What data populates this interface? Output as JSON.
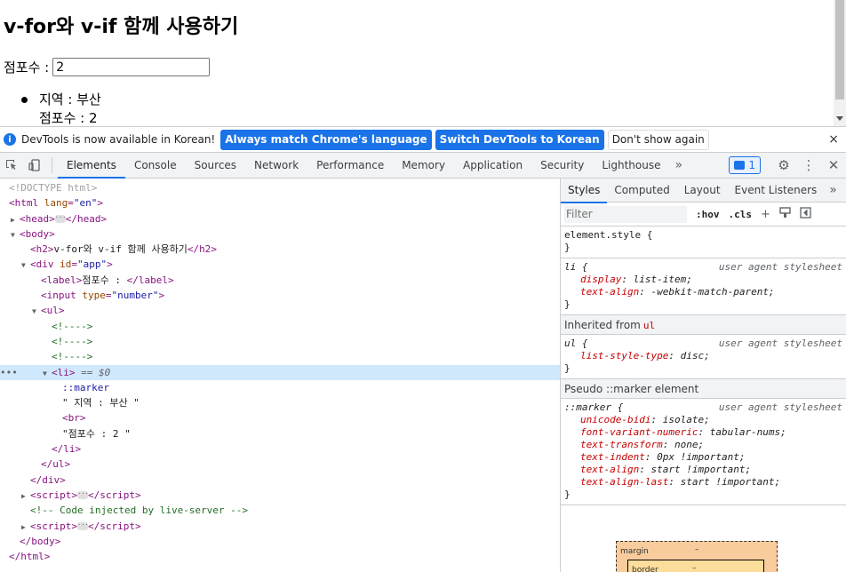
{
  "page": {
    "heading": "v-for와 v-if 함께 사용하기",
    "score_label": "점포수 :",
    "score_value": "2",
    "list_items": [
      {
        "line1": "지역 : 부산",
        "line2": "점포수 : 2"
      }
    ]
  },
  "infobar": {
    "message": "DevTools is now available in Korean!",
    "btn_match": "Always match Chrome's language",
    "btn_switch": "Switch DevTools to Korean",
    "btn_dont_show": "Don't show again",
    "close": "×"
  },
  "toolbar": {
    "tabs": [
      "Elements",
      "Console",
      "Sources",
      "Network",
      "Performance",
      "Memory",
      "Application",
      "Security",
      "Lighthouse"
    ],
    "more": "»",
    "issues_count": "1"
  },
  "elements": {
    "doctype": "<!DOCTYPE html>",
    "html_tag": "html",
    "html_attr": "lang",
    "html_attr_val": "\"en\"",
    "head_tag": "head",
    "body_tag": "body",
    "h2_tag": "h2",
    "h2_text": "v-for와 v-if 함께 사용하기",
    "div_tag": "div",
    "div_attr": "id",
    "div_attr_val": "\"app\"",
    "label_tag": "label",
    "label_text": "점포수 : ",
    "input_tag": "input",
    "input_attr": "type",
    "input_attr_val": "\"number\"",
    "ul_tag": "ul",
    "comment_empty": "<!---->",
    "li_tag": "li",
    "selected_marker": "== $0",
    "marker_pseudo": "::marker",
    "text_region": "\" 지역 : 부산 \"",
    "br_tag": "br",
    "text_score": "\"점포수 : 2 \"",
    "script_tag": "script",
    "comment_live": "<!-- Code injected by live-server -->",
    "dots": "•••"
  },
  "styles": {
    "tabs": [
      "Styles",
      "Computed",
      "Layout",
      "Event Listeners"
    ],
    "more": "»",
    "filter_placeholder": "Filter",
    "hov": ":hov",
    "cls": ".cls",
    "element_style": "element.style {",
    "close_brace": "}",
    "li_selector": "li {",
    "ua_source": "user agent stylesheet",
    "li_decls": [
      {
        "prop": "display",
        "val": "list-item;"
      },
      {
        "prop": "text-align",
        "val": "-webkit-match-parent;"
      }
    ],
    "inherited_label": "Inherited from",
    "inherited_from": "ul",
    "ul_selector": "ul {",
    "ul_decls": [
      {
        "prop": "list-style-type",
        "val": "disc;"
      }
    ],
    "pseudo_label": "Pseudo ::marker element",
    "marker_selector": "::marker {",
    "marker_decls": [
      {
        "prop": "unicode-bidi",
        "val": "isolate;"
      },
      {
        "prop": "font-variant-numeric",
        "val": "tabular-nums;"
      },
      {
        "prop": "text-transform",
        "val": "none;"
      },
      {
        "prop": "text-indent",
        "val": "0px !important;"
      },
      {
        "prop": "text-align",
        "val": "start !important;"
      },
      {
        "prop": "text-align-last",
        "val": "start !important;"
      }
    ],
    "box_margin": "margin",
    "box_border": "border",
    "box_dash": "–"
  }
}
